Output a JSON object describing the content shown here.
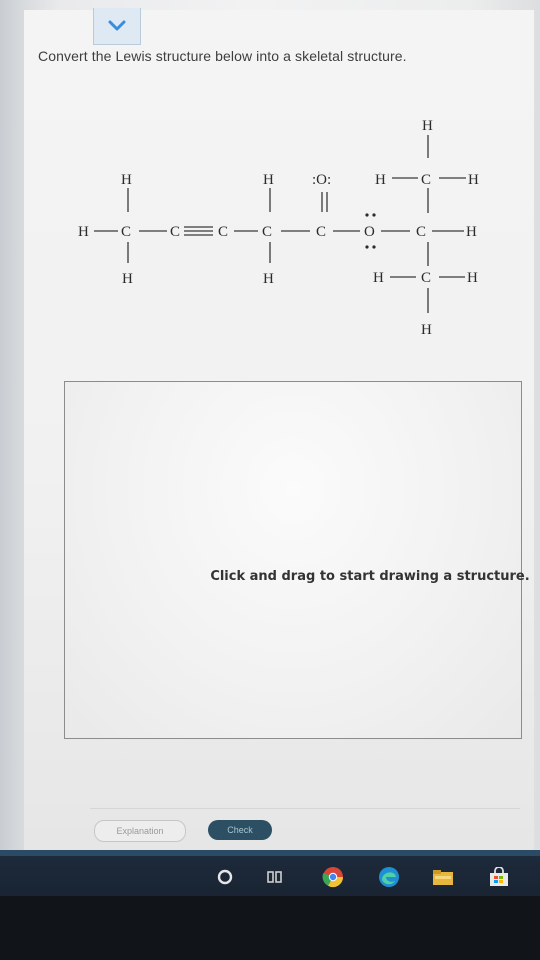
{
  "question": {
    "prompt": "Convert the Lewis structure below into a skeletal structure."
  },
  "lewis": {
    "atoms": {
      "h_top_left": "H",
      "h_left": "H",
      "c1": "C",
      "c2": "C",
      "c3": "C",
      "h_bottom_left": "H",
      "h_top_c4": "H",
      "c4": "C",
      "h_bottom_c4": "H",
      "o_carbonyl": ":O:",
      "c5": "C",
      "o_ester": "O",
      "h_top_top": "H",
      "h_mid_left": "H",
      "c_top": "C",
      "h_mid_right": "H",
      "c6": "C",
      "h_right": "H",
      "h_bot_left": "H",
      "c_bot": "C",
      "h_bot_right": "H",
      "h_bottom_end": "H"
    }
  },
  "canvas": {
    "hint": "Click and drag to start drawing a structure."
  },
  "buttons": {
    "explanation": "Explanation",
    "check": "Check"
  },
  "taskbar": {
    "icons": [
      "cortana-circle-icon",
      "task-view-icon",
      "chrome-icon",
      "edge-icon",
      "file-explorer-icon",
      "store-icon"
    ]
  }
}
